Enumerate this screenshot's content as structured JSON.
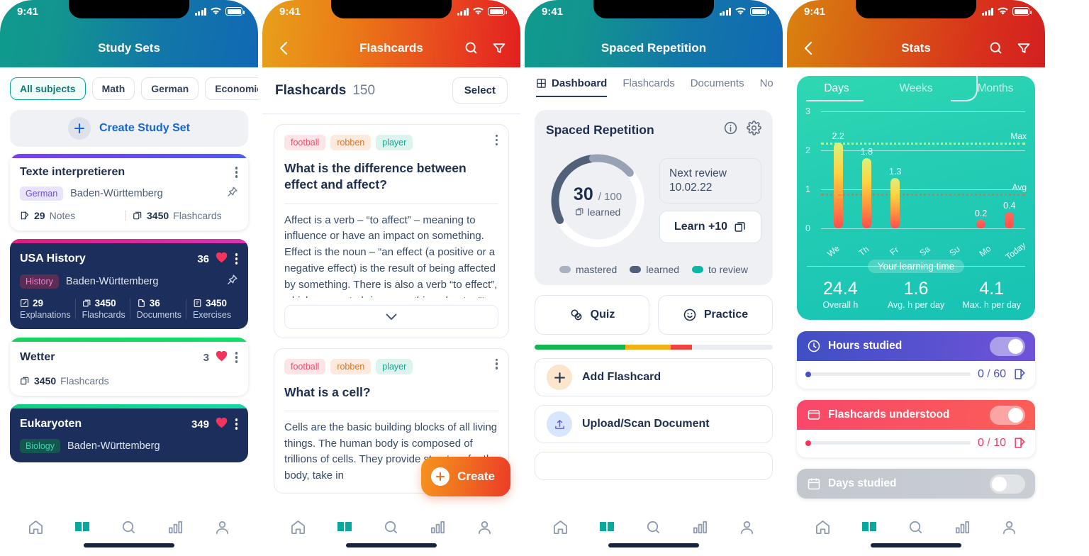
{
  "status": {
    "time": "9:41"
  },
  "phone1": {
    "header": {
      "title": "Study Sets"
    },
    "filters": [
      {
        "label": "All subjects",
        "active": true
      },
      {
        "label": "Math",
        "active": false
      },
      {
        "label": "German",
        "active": false
      },
      {
        "label": "Economics",
        "active": false
      }
    ],
    "create_label": "Create Study Set",
    "sets": [
      {
        "name": "Texte interpretieren",
        "tag": "German",
        "state": "Baden-Württemberg",
        "count": "",
        "stats": [
          {
            "value": "29",
            "label": "Notes",
            "icon": "note-icon"
          },
          {
            "value": "3450",
            "label": "Flashcards",
            "icon": "cards-icon"
          }
        ]
      },
      {
        "name": "USA History",
        "tag": "History",
        "state": "Baden-Württemberg",
        "count": "36",
        "stats": [
          {
            "value": "29",
            "label": "Explanations",
            "icon": "note-icon"
          },
          {
            "value": "3450",
            "label": "Flashcards",
            "icon": "cards-icon"
          },
          {
            "value": "36",
            "label": "Documents",
            "icon": "doc-icon"
          },
          {
            "value": "3450",
            "label": "Exercises",
            "icon": "exercise-icon"
          }
        ]
      },
      {
        "name": "Wetter",
        "tag": "",
        "state": "",
        "count": "3",
        "stats": [
          {
            "value": "3450",
            "label": "Flashcards",
            "icon": "cards-icon"
          }
        ]
      },
      {
        "name": "Eukaryoten",
        "tag": "Biology",
        "state": "Baden-Württemberg",
        "count": "349",
        "stats": []
      }
    ]
  },
  "phone2": {
    "header": {
      "title": "Flashcards"
    },
    "subheader": {
      "title": "Flashcards",
      "count": "150",
      "select_label": "Select"
    },
    "cards": [
      {
        "tags": [
          "football",
          "robben",
          "player"
        ],
        "question": "What is the difference between effect and affect?",
        "answer": "Affect is a verb – “to affect” – meaning to influence or have an impact on something. Effect is the noun – “an effect (a positive or a negative effect) is the result of being affected by something. There is also a verb “to effect”, which means to bring something about – “to"
      },
      {
        "tags": [
          "football",
          "robben",
          "player"
        ],
        "question": "What is a cell?",
        "answer": "Cells are the basic building blocks of all living things. The human body is composed of trillions of cells. They provide structure for the body, take in"
      }
    ],
    "fab_label": "Create"
  },
  "phone3": {
    "header": {
      "title": "Spaced Repetition"
    },
    "tabs": [
      {
        "label": "Dashboard",
        "active": true
      },
      {
        "label": "Flashcards",
        "active": false
      },
      {
        "label": "Documents",
        "active": false
      },
      {
        "label": "No",
        "active": false
      }
    ],
    "sr": {
      "title": "Spaced Repetition",
      "learned_value": "30",
      "learned_total": "/ 100",
      "learned_label": "learned",
      "next_review_line1": "Next review",
      "next_review_line2": "10.02.22",
      "learn_label": "Learn +10",
      "legend": [
        {
          "label": "mastered",
          "color": "#a8b2c0"
        },
        {
          "label": "learned",
          "color": "#51617a"
        },
        {
          "label": "to review",
          "color": "#0ab8a5"
        }
      ]
    },
    "quick": [
      {
        "label": "Quiz",
        "icon": "quiz-icon"
      },
      {
        "label": "Practice",
        "icon": "smiley-icon"
      }
    ],
    "progress": [
      {
        "color": "#12b84f",
        "pct": 38
      },
      {
        "color": "#f2b017",
        "pct": 19
      },
      {
        "color": "#f0453e",
        "pct": 9
      },
      {
        "color": "#e9ecf1",
        "pct": 34
      }
    ],
    "actions": [
      {
        "label": "Add Flashcard",
        "icon": "plus-icon",
        "bg": "#fde5cb"
      },
      {
        "label": "Upload/Scan Document",
        "icon": "upload-icon",
        "bg": "#d7e6fd"
      }
    ]
  },
  "phone4": {
    "header": {
      "title": "Stats"
    },
    "segments": [
      {
        "label": "Days",
        "active": true
      },
      {
        "label": "Weeks",
        "active": false
      },
      {
        "label": "Months",
        "active": false
      }
    ],
    "chart_footer_label": "Your learning time",
    "kpis": [
      {
        "value": "24.4",
        "label": "Overall h"
      },
      {
        "value": "1.6",
        "label": "Avg. h per day"
      },
      {
        "value": "4.1",
        "label": "Max. h per day"
      }
    ],
    "goals": [
      {
        "title": "Hours studied",
        "icon": "clock-icon",
        "current": "0",
        "total": "60",
        "accent": "#4350c9",
        "gradient": "linear-gradient(95deg,#3f4fc4 0%,#6f53d8 100%)",
        "on": true
      },
      {
        "title": "Flashcards understood",
        "icon": "card-icon",
        "current": "0",
        "total": "10",
        "accent": "#f5365c",
        "gradient": "linear-gradient(95deg,#f9476a 0%,#fa5e57 100%)",
        "on": true
      },
      {
        "title": "Days studied",
        "icon": "calendar-icon",
        "current": "",
        "total": "",
        "accent": "#b9bfc7",
        "gradient": "linear-gradient(95deg,#c3c8ce 0%,#c9ced4 100%)",
        "on": false
      }
    ]
  },
  "chart_data": {
    "type": "bar",
    "title": "Your learning time",
    "categories": [
      "We",
      "Th",
      "Fr",
      "Sa",
      "Su",
      "Mo",
      "Today"
    ],
    "values": [
      2.2,
      1.8,
      1.3,
      0,
      0,
      0.2,
      0.4
    ],
    "ylabel": "",
    "xlabel": "",
    "ylim": [
      0,
      3.2
    ],
    "yticks": [
      0,
      1,
      2,
      3
    ],
    "grid": true,
    "reference_lines": [
      {
        "label": "Max",
        "value": 2.2,
        "color": "#e8e84a",
        "style": "dotted"
      },
      {
        "label": "Avg",
        "value": 0.9,
        "color": "#f26a3a",
        "style": "dotted"
      }
    ],
    "legend_position": "none"
  },
  "tabbar": [
    {
      "name": "home-icon",
      "active": false
    },
    {
      "name": "book-icon",
      "active": true
    },
    {
      "name": "search-icon",
      "active": false
    },
    {
      "name": "stats-icon",
      "active": false
    },
    {
      "name": "profile-icon",
      "active": false
    }
  ]
}
